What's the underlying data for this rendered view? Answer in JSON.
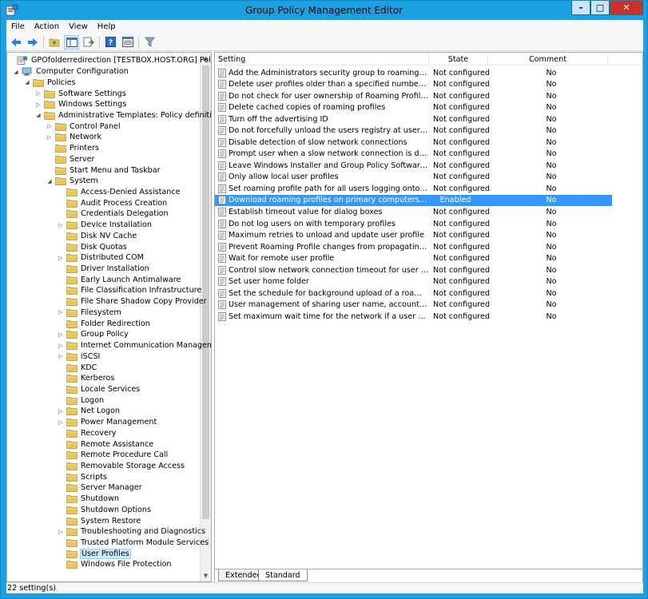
{
  "window": {
    "title": "Group Policy Management Editor",
    "minimize_glyph": "–",
    "maximize_glyph": "□",
    "close_glyph": "✕"
  },
  "menubar": {
    "items": [
      "File",
      "Action",
      "View",
      "Help"
    ]
  },
  "toolbar": {
    "buttons": [
      "back-arrow-icon",
      "forward-arrow-icon",
      "up-folder-icon",
      "show-hide-tree-icon",
      "export-list-icon",
      "help-icon",
      "properties-icon",
      "filter-icon"
    ]
  },
  "tree": {
    "items": [
      {
        "label": "GPOfolderredirection [TESTBOX.HOST.ORG] Policy",
        "level": 0,
        "toggle": "",
        "icon": "policy"
      },
      {
        "label": "Computer Configuration",
        "level": 0,
        "toggle": "◢",
        "icon": "computer"
      },
      {
        "label": "Policies",
        "level": 1,
        "toggle": "◢",
        "icon": "folder"
      },
      {
        "label": "Software Settings",
        "level": 2,
        "toggle": "▷",
        "icon": "folder"
      },
      {
        "label": "Windows Settings",
        "level": 2,
        "toggle": "▷",
        "icon": "folder"
      },
      {
        "label": "Administrative Templates: Policy definitions (",
        "level": 2,
        "toggle": "◢",
        "icon": "folder"
      },
      {
        "label": "Control Panel",
        "level": 3,
        "toggle": "▷",
        "icon": "folder"
      },
      {
        "label": "Network",
        "level": 3,
        "toggle": "▷",
        "icon": "folder"
      },
      {
        "label": "Printers",
        "level": 3,
        "toggle": "",
        "icon": "folder"
      },
      {
        "label": "Server",
        "level": 3,
        "toggle": "",
        "icon": "folder"
      },
      {
        "label": "Start Menu and Taskbar",
        "level": 3,
        "toggle": "",
        "icon": "folder"
      },
      {
        "label": "System",
        "level": 3,
        "toggle": "◢",
        "icon": "folder"
      },
      {
        "label": "Access-Denied Assistance",
        "level": 4,
        "toggle": "",
        "icon": "folder"
      },
      {
        "label": "Audit Process Creation",
        "level": 4,
        "toggle": "",
        "icon": "folder"
      },
      {
        "label": "Credentials Delegation",
        "level": 4,
        "toggle": "",
        "icon": "folder"
      },
      {
        "label": "Device Installation",
        "level": 4,
        "toggle": "▷",
        "icon": "folder"
      },
      {
        "label": "Disk NV Cache",
        "level": 4,
        "toggle": "",
        "icon": "folder"
      },
      {
        "label": "Disk Quotas",
        "level": 4,
        "toggle": "",
        "icon": "folder"
      },
      {
        "label": "Distributed COM",
        "level": 4,
        "toggle": "▷",
        "icon": "folder"
      },
      {
        "label": "Driver Installation",
        "level": 4,
        "toggle": "",
        "icon": "folder"
      },
      {
        "label": "Early Launch Antimalware",
        "level": 4,
        "toggle": "",
        "icon": "folder"
      },
      {
        "label": "File Classification Infrastructure",
        "level": 4,
        "toggle": "",
        "icon": "folder"
      },
      {
        "label": "File Share Shadow Copy Provider",
        "level": 4,
        "toggle": "",
        "icon": "folder"
      },
      {
        "label": "Filesystem",
        "level": 4,
        "toggle": "▷",
        "icon": "folder"
      },
      {
        "label": "Folder Redirection",
        "level": 4,
        "toggle": "",
        "icon": "folder"
      },
      {
        "label": "Group Policy",
        "level": 4,
        "toggle": "▷",
        "icon": "folder"
      },
      {
        "label": "Internet Communication Managem",
        "level": 4,
        "toggle": "▷",
        "icon": "folder"
      },
      {
        "label": "iSCSI",
        "level": 4,
        "toggle": "▷",
        "icon": "folder"
      },
      {
        "label": "KDC",
        "level": 4,
        "toggle": "",
        "icon": "folder"
      },
      {
        "label": "Kerberos",
        "level": 4,
        "toggle": "",
        "icon": "folder"
      },
      {
        "label": "Locale Services",
        "level": 4,
        "toggle": "",
        "icon": "folder"
      },
      {
        "label": "Logon",
        "level": 4,
        "toggle": "",
        "icon": "folder"
      },
      {
        "label": "Net Logon",
        "level": 4,
        "toggle": "▷",
        "icon": "folder"
      },
      {
        "label": "Power Management",
        "level": 4,
        "toggle": "▷",
        "icon": "folder"
      },
      {
        "label": "Recovery",
        "level": 4,
        "toggle": "",
        "icon": "folder"
      },
      {
        "label": "Remote Assistance",
        "level": 4,
        "toggle": "",
        "icon": "folder"
      },
      {
        "label": "Remote Procedure Call",
        "level": 4,
        "toggle": "",
        "icon": "folder"
      },
      {
        "label": "Removable Storage Access",
        "level": 4,
        "toggle": "",
        "icon": "folder"
      },
      {
        "label": "Scripts",
        "level": 4,
        "toggle": "",
        "icon": "folder"
      },
      {
        "label": "Server Manager",
        "level": 4,
        "toggle": "",
        "icon": "folder"
      },
      {
        "label": "Shutdown",
        "level": 4,
        "toggle": "",
        "icon": "folder"
      },
      {
        "label": "Shutdown Options",
        "level": 4,
        "toggle": "",
        "icon": "folder"
      },
      {
        "label": "System Restore",
        "level": 4,
        "toggle": "",
        "icon": "folder"
      },
      {
        "label": "Troubleshooting and Diagnostics",
        "level": 4,
        "toggle": "▷",
        "icon": "folder"
      },
      {
        "label": "Trusted Platform Module Services",
        "level": 4,
        "toggle": "",
        "icon": "folder"
      },
      {
        "label": "User Profiles",
        "level": 4,
        "toggle": "",
        "icon": "folder",
        "selected": true
      },
      {
        "label": "Windows File Protection",
        "level": 4,
        "toggle": "",
        "icon": "folder"
      }
    ]
  },
  "list": {
    "columns": {
      "setting": "Setting",
      "state": "State",
      "comment": "Comment"
    },
    "rows": [
      {
        "setting": "Add the Administrators security group to roaming user profi...",
        "state": "Not configured",
        "comment": "No"
      },
      {
        "setting": "Delete user profiles older than a specified number of days o...",
        "state": "Not configured",
        "comment": "No"
      },
      {
        "setting": "Do not check for user ownership of Roaming Profile Folders",
        "state": "Not configured",
        "comment": "No"
      },
      {
        "setting": "Delete cached copies of roaming profiles",
        "state": "Not configured",
        "comment": "No"
      },
      {
        "setting": "Turn off the advertising ID",
        "state": "Not configured",
        "comment": "No"
      },
      {
        "setting": "Do not forcefully unload the users registry at user logoff",
        "state": "Not configured",
        "comment": "No"
      },
      {
        "setting": "Disable detection of slow network connections",
        "state": "Not configured",
        "comment": "No"
      },
      {
        "setting": "Prompt user when a slow network connection is detected",
        "state": "Not configured",
        "comment": "No"
      },
      {
        "setting": "Leave Windows Installer and Group Policy Software Installati...",
        "state": "Not configured",
        "comment": "No"
      },
      {
        "setting": "Only allow local user profiles",
        "state": "Not configured",
        "comment": "No"
      },
      {
        "setting": "Set roaming profile path for all users logging onto this com...",
        "state": "Not configured",
        "comment": "No"
      },
      {
        "setting": "Download roaming profiles on primary computers only",
        "state": "Enabled",
        "comment": "No",
        "selected": true
      },
      {
        "setting": "Establish timeout value for dialog boxes",
        "state": "Not configured",
        "comment": "No"
      },
      {
        "setting": "Do not log users on with temporary profiles",
        "state": "Not configured",
        "comment": "No"
      },
      {
        "setting": "Maximum retries to unload and update user profile",
        "state": "Not configured",
        "comment": "No"
      },
      {
        "setting": "Prevent Roaming Profile changes from propagating to the s...",
        "state": "Not configured",
        "comment": "No"
      },
      {
        "setting": "Wait for remote user profile",
        "state": "Not configured",
        "comment": "No"
      },
      {
        "setting": "Control slow network connection timeout for user profiles",
        "state": "Not configured",
        "comment": "No"
      },
      {
        "setting": "Set user home folder",
        "state": "Not configured",
        "comment": "No"
      },
      {
        "setting": "Set the schedule for background upload of a roaming user p...",
        "state": "Not configured",
        "comment": "No"
      },
      {
        "setting": "User management of sharing user name, account picture, a...",
        "state": "Not configured",
        "comment": "No"
      },
      {
        "setting": "Set maximum wait time for the network if a user has a roami...",
        "state": "Not configured",
        "comment": "No"
      }
    ]
  },
  "tabs": {
    "extended": "Extended",
    "standard": "Standard"
  },
  "status": {
    "text": "22 setting(s)"
  },
  "colors": {
    "titlebar": "#1ba1e2",
    "selection": "#3399ff",
    "folder": "#e8c25a"
  }
}
